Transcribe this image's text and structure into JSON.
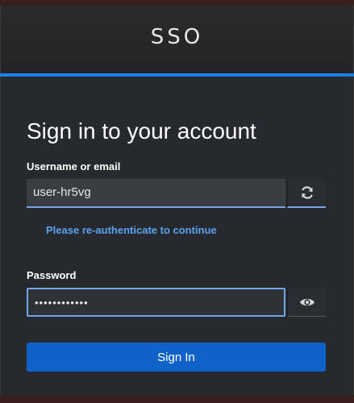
{
  "header": {
    "brand": "SSO"
  },
  "form": {
    "title": "Sign in to your account",
    "username_label": "Username or email",
    "username_value": "user-hr5vg",
    "reauth_hint": "Please re-authenticate to continue",
    "password_label": "Password",
    "password_value": "••••••••••••",
    "submit_label": "Sign In"
  },
  "icons": {
    "refresh": "refresh-icon",
    "show_password": "eye-icon"
  },
  "colors": {
    "accent": "#1b7ff0",
    "button": "#0f62c8",
    "link": "#5ba3f0",
    "focus_border": "#73a5e8",
    "background": "#26292d"
  }
}
